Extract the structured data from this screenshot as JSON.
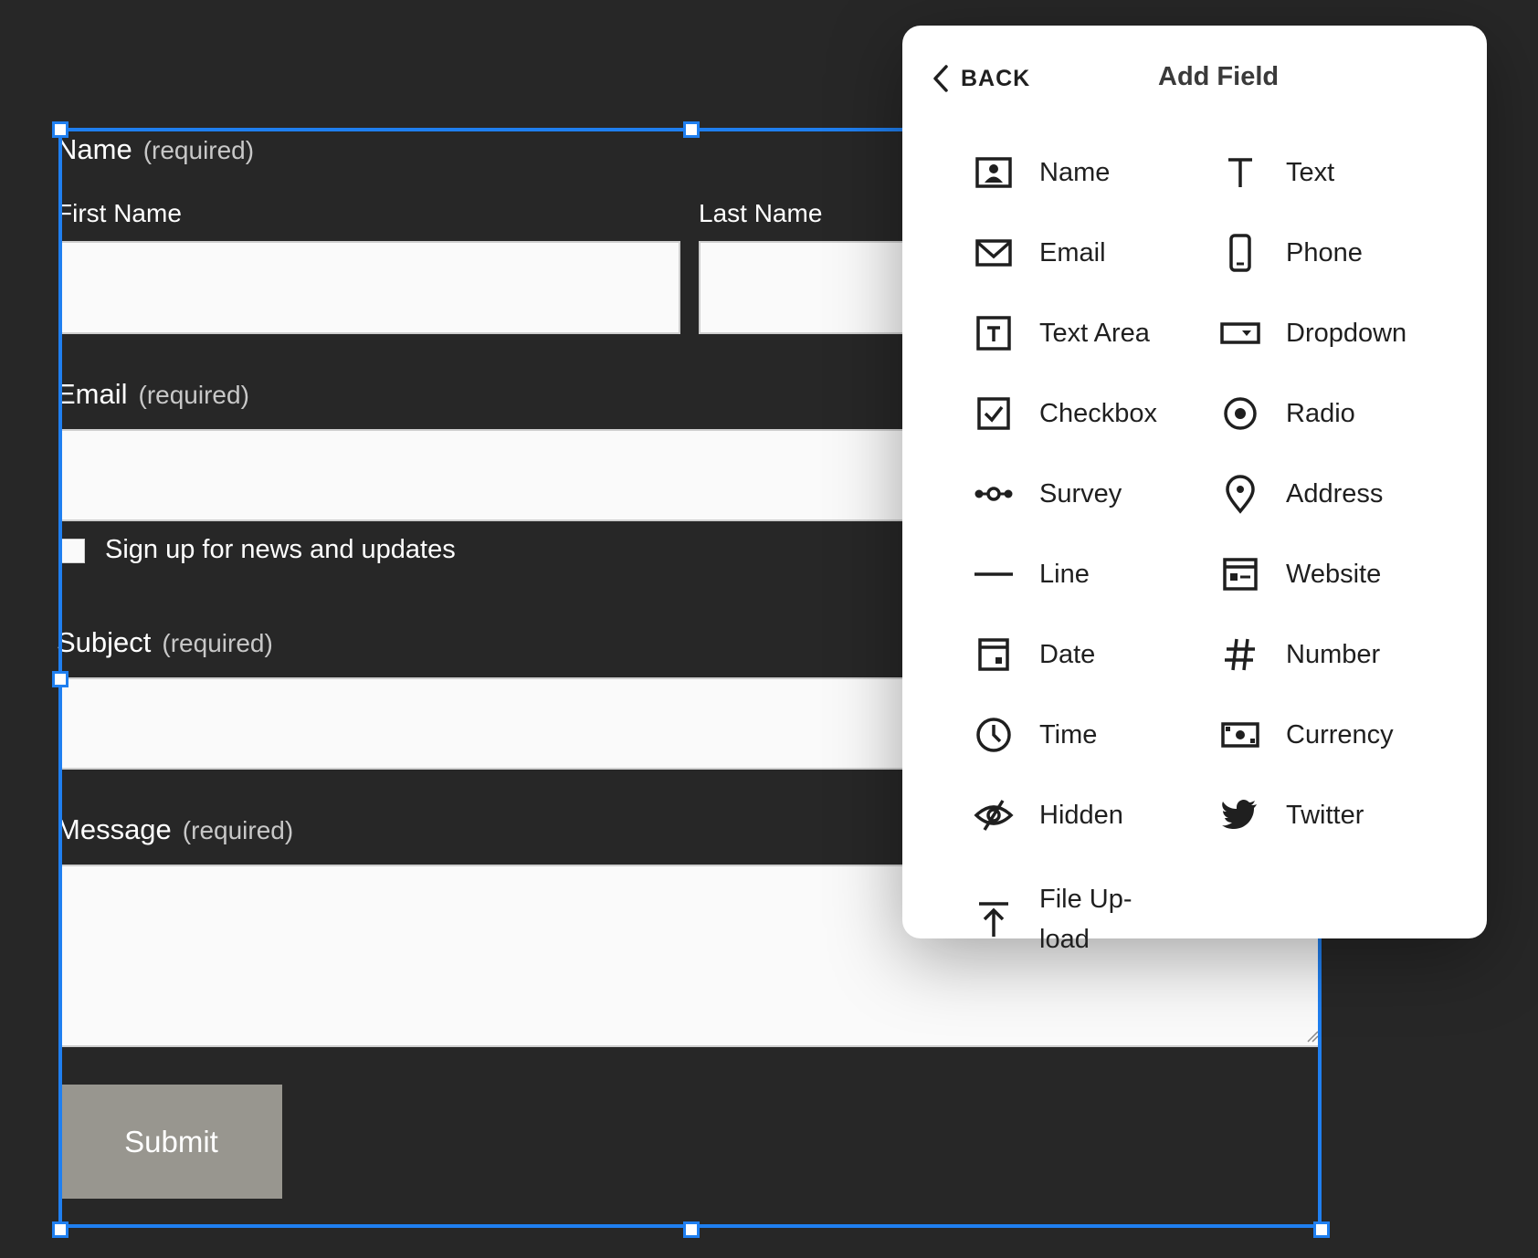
{
  "form": {
    "name": {
      "label": "Name",
      "required": "(required)",
      "first_label": "First Name",
      "last_label": "Last Name"
    },
    "email": {
      "label": "Email",
      "required": "(required)"
    },
    "newsletter": {
      "label": "Sign up for news and updates",
      "checked": false
    },
    "subject": {
      "label": "Subject",
      "required": "(required)"
    },
    "message": {
      "label": "Message",
      "required": "(required)"
    },
    "submit_label": "Submit"
  },
  "panel": {
    "back_label": "BACK",
    "title": "Add Field",
    "fields": [
      {
        "label": "Name",
        "icon": "name-card-icon"
      },
      {
        "label": "Text",
        "icon": "text-icon"
      },
      {
        "label": "Email",
        "icon": "envelope-icon"
      },
      {
        "label": "Phone",
        "icon": "phone-icon"
      },
      {
        "label": "Text Area",
        "icon": "text-area-icon"
      },
      {
        "label": "Dropdown",
        "icon": "dropdown-icon"
      },
      {
        "label": "Checkbox",
        "icon": "checkbox-icon"
      },
      {
        "label": "Radio",
        "icon": "radio-icon"
      },
      {
        "label": "Survey",
        "icon": "survey-icon"
      },
      {
        "label": "Address",
        "icon": "map-pin-icon"
      },
      {
        "label": "Line",
        "icon": "line-icon"
      },
      {
        "label": "Website",
        "icon": "website-icon"
      },
      {
        "label": "Date",
        "icon": "calendar-icon"
      },
      {
        "label": "Number",
        "icon": "hash-icon"
      },
      {
        "label": "Time",
        "icon": "clock-icon"
      },
      {
        "label": "Currency",
        "icon": "banknote-icon"
      },
      {
        "label": "Hidden",
        "icon": "eye-off-icon"
      },
      {
        "label": "Twitter",
        "icon": "twitter-bird-icon"
      },
      {
        "label": "File Up-\nload",
        "icon": "upload-icon"
      }
    ]
  },
  "colors": {
    "background": "#272727",
    "selection": "#1f7ff0",
    "submit": "#98968f",
    "panel": "#ffffff"
  }
}
